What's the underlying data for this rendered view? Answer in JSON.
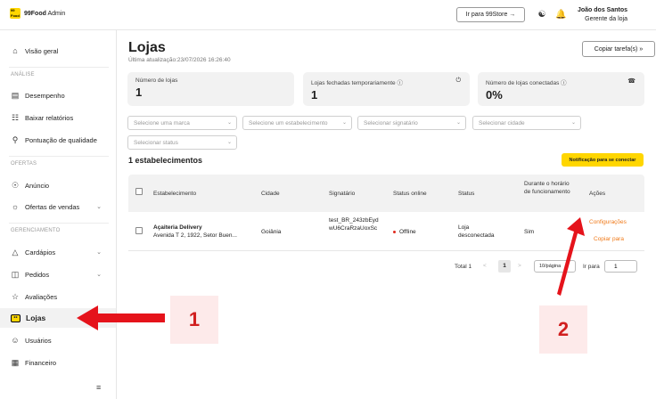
{
  "app": {
    "logo_mark": "99 Food",
    "brand": "99Food",
    "suffix": " Admin"
  },
  "topbar": {
    "store_button": "Ir para 99Store →",
    "icons": [
      "headset-icon",
      "bell-icon"
    ],
    "user_name": "João dos Santos",
    "user_role": "Gerente da loja"
  },
  "sidebar": {
    "items": [
      {
        "label": "Visão geral",
        "icon": "home-icon"
      },
      {
        "label": "Desempenho",
        "icon": "chart-icon"
      },
      {
        "label": "Baixar relatórios",
        "icon": "report-icon"
      },
      {
        "label": "Pontuação de qualidade",
        "icon": "trophy-icon"
      },
      {
        "label": "Anúncio",
        "icon": "megaphone-icon"
      },
      {
        "label": "Ofertas de vendas",
        "icon": "offer-icon"
      },
      {
        "label": "Cardápios",
        "icon": "menu-icon"
      },
      {
        "label": "Pedidos",
        "icon": "bag-icon"
      },
      {
        "label": "Avaliações",
        "icon": "star-icon"
      },
      {
        "label": "Lojas",
        "icon": "store-icon"
      },
      {
        "label": "Usuários",
        "icon": "users-icon"
      },
      {
        "label": "Financeiro",
        "icon": "finance-icon"
      }
    ],
    "sections": [
      "ANÁLISE",
      "OFERTAS",
      "GERENCIAMENTO"
    ],
    "active": "Lojas"
  },
  "main": {
    "title": "Lojas",
    "updated": "Última atualização:23/07/2026 16:26:40",
    "copy_tasks": "Copiar tarefa(s)  »",
    "cards": [
      {
        "label": "Número de lojas",
        "value": "1"
      },
      {
        "label": "Lojas fechadas temporariamente ⓘ",
        "value": "1"
      },
      {
        "label": "Número de lojas conectadas ⓘ",
        "value": "0%"
      }
    ],
    "filters": [
      "Selecione uma marca",
      "Selecione um estabelecimento",
      "Selecionar signatário",
      "Selecionar cidade",
      "Selecionar status"
    ],
    "count_label": "1 estabelecimentos",
    "notify_button": "Notificação para se conectar"
  },
  "table": {
    "headers": [
      "Estabelecimento",
      "Cidade",
      "Signatário",
      "Status online",
      "Status",
      "Durante o horário de funcionamento",
      "Ações"
    ],
    "rows": [
      {
        "name": "Açaiteria Delivery",
        "address": "Avenida T 2, 1922, Setor Buen...",
        "city": "Goiânia",
        "signer": "test_BR_243zbEydwU6CraRzaUoxSc",
        "online_status": "Offline",
        "status": "Loja desconectada",
        "during_hours": "Sim",
        "action_config": "Configurações",
        "action_copy": "Copiar para"
      }
    ]
  },
  "pagination": {
    "total": "Total 1",
    "prev": "<",
    "page": "1",
    "next": ">",
    "page_size": "10/página",
    "goto_label": "Ir para",
    "goto_value": "1"
  },
  "annotations": {
    "step1": "1",
    "step2": "2",
    "arrow_color": "#e5131b"
  }
}
